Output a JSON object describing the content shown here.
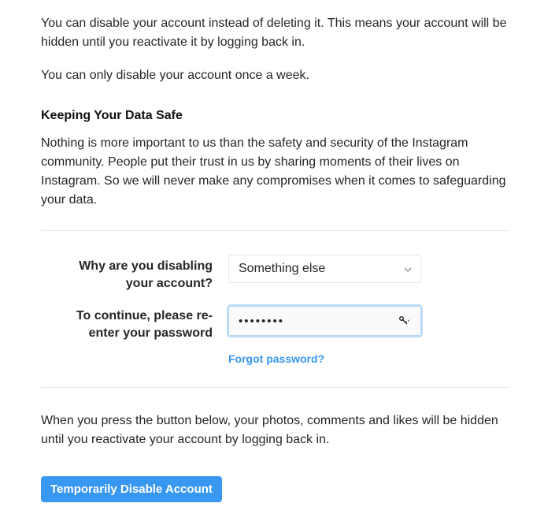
{
  "intro": {
    "p1": "You can disable your account instead of deleting it. This means your account will be hidden until you reactivate it by logging back in.",
    "p2": "You can only disable your account once a week."
  },
  "safety_section": {
    "heading": "Keeping Your Data Safe",
    "body": "Nothing is more important to us than the safety and security of the Instagram community. People put their trust in us by sharing moments of their lives on Instagram. So we will never make any compromises when it comes to safeguarding your data."
  },
  "form": {
    "reason_label": "Why are you disabling your account?",
    "reason_value": "Something else",
    "password_label": "To continue, please re-enter your password",
    "password_value": "••••••••",
    "forgot_link": "Forgot password?"
  },
  "confirm": {
    "note": "When you press the button below, your photos, comments and likes will be hidden until you reactivate your account by logging back in.",
    "button_label": "Temporarily Disable Account"
  }
}
